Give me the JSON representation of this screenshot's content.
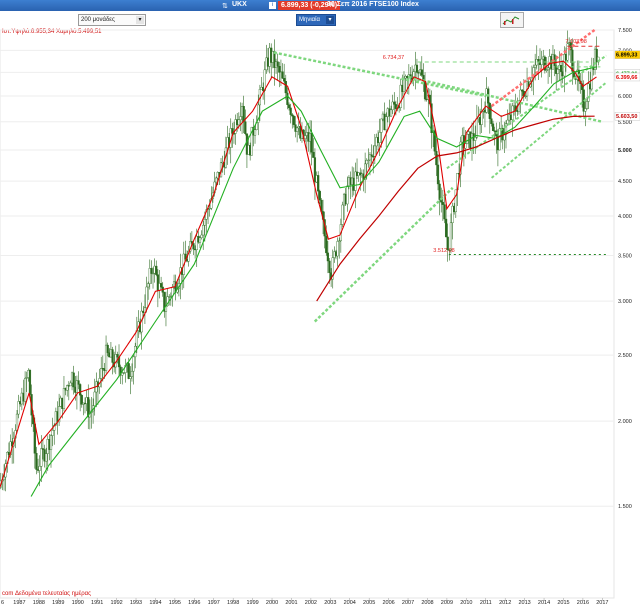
{
  "header": {
    "symbol": "UKX",
    "price_badge": "6.899,33 (-0,29%)",
    "date_title": "30 Σεπ 2016 FTSE100 Index",
    "period_select": "200 μονάδες",
    "interval_select": "Μηνιαία",
    "hilo_text": "Ιστ.Υψηλό:6.955,34 Χαμηλό:5.499,51",
    "footer_text": "com  Δεδομένα τελευταίας ημέρας"
  },
  "colors": {
    "candle_up": "#2a6a1f",
    "candle_down": "#2a6a1f",
    "ma_red": "#e00000",
    "ma_green": "#22b022",
    "ma_darkred": "#c00000",
    "trend_green": "#7fd77f",
    "trend_red": "#ff7070",
    "price_badge_bg": "#ffcc00"
  },
  "chart_data": {
    "type": "candlestick",
    "title": "30 Σεπ 2016 FTSE100 Index",
    "y_scale": "log",
    "ylim": [
      1100,
      7500
    ],
    "y_ticks": [
      {
        "v": 7500,
        "label": "7.500"
      },
      {
        "v": 7000,
        "label": "7.000"
      },
      {
        "v": 6500,
        "label": "6.500"
      },
      {
        "v": 6000,
        "label": "6.000"
      },
      {
        "v": 5500,
        "label": "5.500"
      },
      {
        "v": 5000,
        "label": "5.000"
      },
      {
        "v": 4500,
        "label": "4.500"
      },
      {
        "v": 4000,
        "label": "4.000"
      },
      {
        "v": 3500,
        "label": "3.500"
      },
      {
        "v": 3000,
        "label": "3.000"
      },
      {
        "v": 2500,
        "label": "2.500"
      },
      {
        "v": 2000,
        "label": "2.000"
      },
      {
        "v": 1500,
        "label": "1.500"
      },
      {
        "v": 1000,
        "label": "1.000"
      }
    ],
    "x_ticks": [
      "1987",
      "1988",
      "1989",
      "1990",
      "1991",
      "1992",
      "1993",
      "1994",
      "1995",
      "1996",
      "1997",
      "1998",
      "1999",
      "2000",
      "2001",
      "2002",
      "2003",
      "2004",
      "2005",
      "2006",
      "2007",
      "2008",
      "2009",
      "2010",
      "2011",
      "2012",
      "2013",
      "2014",
      "2015",
      "2016",
      "2017"
    ],
    "x_first_label": "6",
    "price_path": [
      [
        1986.0,
        1600
      ],
      [
        1987.5,
        2350
      ],
      [
        1987.9,
        1700
      ],
      [
        1988.5,
        1850
      ],
      [
        1989.7,
        2350
      ],
      [
        1990.7,
        2050
      ],
      [
        1991.5,
        2500
      ],
      [
        1992.7,
        2350
      ],
      [
        1993.9,
        3400
      ],
      [
        1994.5,
        2950
      ],
      [
        1995.5,
        3400
      ],
      [
        1996.5,
        3900
      ],
      [
        1997.7,
        5000
      ],
      [
        1998.5,
        5900
      ],
      [
        1998.8,
        4900
      ],
      [
        1999.9,
        6930
      ],
      [
        2000.5,
        6400
      ],
      [
        2001.5,
        5200
      ],
      [
        2002.0,
        5200
      ],
      [
        2002.5,
        4100
      ],
      [
        2003.1,
        3300
      ],
      [
        2003.9,
        4400
      ],
      [
        2004.7,
        4600
      ],
      [
        2005.9,
        5600
      ],
      [
        2006.5,
        5900
      ],
      [
        2007.5,
        6730
      ],
      [
        2008.1,
        5900
      ],
      [
        2008.7,
        4300
      ],
      [
        2009.1,
        3550
      ],
      [
        2009.8,
        5100
      ],
      [
        2010.4,
        5200
      ],
      [
        2011.1,
        6000
      ],
      [
        2011.6,
        5100
      ],
      [
        2012.5,
        5700
      ],
      [
        2013.5,
        6600
      ],
      [
        2014.3,
        6800
      ],
      [
        2014.9,
        6500
      ],
      [
        2015.3,
        7100
      ],
      [
        2015.9,
        6100
      ],
      [
        2016.1,
        5800
      ],
      [
        2016.7,
        6899
      ]
    ],
    "series": [
      {
        "name": "",
        "color": "#e00000",
        "width": 1.1,
        "values": [
          [
            1986.0,
            1600
          ],
          [
            1987.5,
            2200
          ],
          [
            1988.0,
            1850
          ],
          [
            1989.0,
            2000
          ],
          [
            1990.0,
            2200
          ],
          [
            1991.0,
            2250
          ],
          [
            1992.0,
            2450
          ],
          [
            1993.0,
            2700
          ],
          [
            1994.0,
            3100
          ],
          [
            1995.0,
            3150
          ],
          [
            1996.0,
            3700
          ],
          [
            1997.0,
            4300
          ],
          [
            1998.0,
            5300
          ],
          [
            1999.0,
            5700
          ],
          [
            2000.0,
            6400
          ],
          [
            2000.8,
            6200
          ],
          [
            2001.5,
            5400
          ],
          [
            2002.3,
            4300
          ],
          [
            2002.9,
            3700
          ],
          [
            2003.5,
            3750
          ],
          [
            2004.5,
            4400
          ],
          [
            2005.5,
            5000
          ],
          [
            2006.5,
            5800
          ],
          [
            2007.3,
            6400
          ],
          [
            2007.9,
            6300
          ],
          [
            2008.5,
            5200
          ],
          [
            2009.0,
            4100
          ],
          [
            2009.5,
            4300
          ],
          [
            2010.0,
            5300
          ],
          [
            2011.0,
            5800
          ],
          [
            2011.8,
            5600
          ],
          [
            2012.5,
            5700
          ],
          [
            2013.5,
            6400
          ],
          [
            2014.3,
            6700
          ],
          [
            2015.0,
            6750
          ],
          [
            2015.6,
            6500
          ],
          [
            2016.0,
            6200
          ],
          [
            2016.7,
            6400
          ]
        ]
      },
      {
        "name": "",
        "color": "#22b022",
        "width": 1.1,
        "values": [
          [
            1987.6,
            1550
          ],
          [
            1988.5,
            1720
          ],
          [
            1990.0,
            1950
          ],
          [
            1992.0,
            2300
          ],
          [
            1994.0,
            2800
          ],
          [
            1996.0,
            3400
          ],
          [
            1998.0,
            4700
          ],
          [
            1999.5,
            5700
          ],
          [
            2000.8,
            6000
          ],
          [
            2001.5,
            5700
          ],
          [
            2002.5,
            5000
          ],
          [
            2003.5,
            4400
          ],
          [
            2004.5,
            4450
          ],
          [
            2005.5,
            4800
          ],
          [
            2006.8,
            5600
          ],
          [
            2007.6,
            5700
          ],
          [
            2008.5,
            5200
          ],
          [
            2009.5,
            5050
          ],
          [
            2010.5,
            5250
          ],
          [
            2011.5,
            5200
          ],
          [
            2012.5,
            5400
          ],
          [
            2013.5,
            5800
          ],
          [
            2014.5,
            6250
          ],
          [
            2015.5,
            6500
          ],
          [
            2016.7,
            6620
          ]
        ]
      },
      {
        "name": "",
        "color": "#c00000",
        "width": 1.2,
        "values": [
          [
            2002.3,
            3000
          ],
          [
            2003.5,
            3400
          ],
          [
            2004.5,
            3700
          ],
          [
            2005.5,
            4000
          ],
          [
            2006.5,
            4350
          ],
          [
            2007.5,
            4700
          ],
          [
            2008.5,
            4900
          ],
          [
            2009.5,
            4950
          ],
          [
            2010.5,
            5050
          ],
          [
            2011.5,
            5200
          ],
          [
            2012.5,
            5350
          ],
          [
            2013.5,
            5450
          ],
          [
            2014.5,
            5550
          ],
          [
            2015.5,
            5600
          ],
          [
            2016.6,
            5604
          ]
        ]
      }
    ],
    "trendlines": [
      {
        "color": "#7fd77f",
        "dash": "3,2",
        "width": 2.5,
        "pts": [
          [
            2000.1,
            6950
          ],
          [
            2011.0,
            6000
          ]
        ]
      },
      {
        "color": "#7fd77f",
        "dash": "3,2",
        "width": 2.5,
        "pts": [
          [
            2007.0,
            6400
          ],
          [
            2017.0,
            5500
          ]
        ]
      },
      {
        "color": "#7fd77f",
        "dash": "3,2",
        "width": 2.5,
        "pts": [
          [
            2002.2,
            2800
          ],
          [
            2009.3,
            4400
          ]
        ]
      },
      {
        "color": "#7fd77f",
        "dash": "3,2",
        "width": 2.0,
        "pts": [
          [
            2009.0,
            4700
          ],
          [
            2017.2,
            6880
          ]
        ]
      },
      {
        "color": "#7fd77f",
        "dash": "3,2",
        "width": 2.0,
        "pts": [
          [
            2011.3,
            4550
          ],
          [
            2017.2,
            6280
          ]
        ]
      },
      {
        "color": "#ff7070",
        "dash": "3,2",
        "width": 2.5,
        "pts": [
          [
            2011.3,
            5800
          ],
          [
            2016.6,
            7500
          ]
        ]
      },
      {
        "color": "#7fd77f",
        "dash": "4,3",
        "width": 1.0,
        "pts": [
          [
            2007.5,
            6730
          ],
          [
            2016.3,
            6730
          ]
        ]
      },
      {
        "color": "#e03030",
        "dash": "4,3",
        "width": 1.0,
        "pts": [
          [
            2015.2,
            7100
          ],
          [
            2016.9,
            7100
          ]
        ]
      },
      {
        "color": "#228822",
        "dash": "2,3",
        "width": 1.0,
        "pts": [
          [
            2009.1,
            3512
          ],
          [
            2017.2,
            3512
          ]
        ]
      },
      {
        "color": "#7fd77f",
        "dash": "4,3",
        "width": 1.0,
        "pts": [
          [
            2014.6,
            6620
          ],
          [
            2016.9,
            6620
          ]
        ]
      }
    ],
    "annotations": [
      {
        "text": "6.734,37",
        "x": 2005.7,
        "y": 6800,
        "color": "#e02020"
      },
      {
        "text": "7.103,98",
        "x": 2015.1,
        "y": 7180,
        "color": "#e02020"
      },
      {
        "text": "3.512,08",
        "x": 2008.3,
        "y": 3540,
        "color": "#e02020"
      }
    ],
    "right_labels": [
      {
        "v": 6899,
        "text": "6.899,33",
        "bg": "#ffcc00",
        "fg": "#000000"
      },
      {
        "v": 6477,
        "text": "6.477,06",
        "bg": "#ffffff",
        "fg": "#22a022"
      },
      {
        "v": 6399,
        "text": "6.399,66",
        "bg": "#ffffff",
        "fg": "#e00000"
      },
      {
        "v": 5604,
        "text": "5.603,50",
        "bg": "#ffffff",
        "fg": "#c00000"
      }
    ]
  }
}
